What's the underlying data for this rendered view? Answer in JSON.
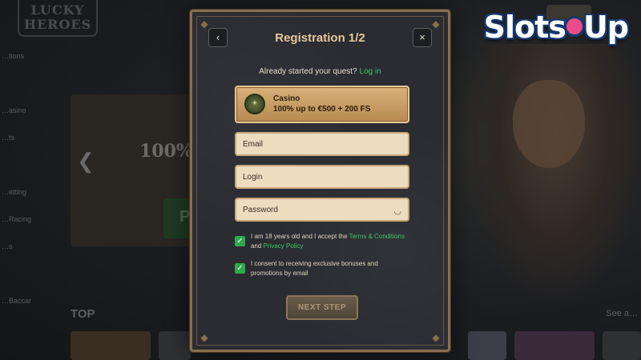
{
  "background": {
    "logo_text": "LUCKY HEROES",
    "sidebar_items": [
      "…tions",
      "",
      "…asino",
      "…ts",
      "",
      "…etting",
      "…Racing",
      "…s",
      "",
      "…Baccar"
    ],
    "banner_text": "100%",
    "banner_button": "P",
    "top_label": "TOP",
    "see_all": "See a…"
  },
  "watermark": {
    "text_left": "Slots",
    "text_right": "Up"
  },
  "modal": {
    "title": "Registration 1/2",
    "back_icon": "chevron-left-icon",
    "close_icon": "close-icon",
    "back_glyph": "‹",
    "close_glyph": "×",
    "quest_text": "Already started your quest?",
    "login_link": "Log in",
    "bonus": {
      "category": "Casino",
      "offer": "100% up to €500 + 200 FS"
    },
    "email_placeholder": "Email",
    "login_placeholder": "Login",
    "password_placeholder": "Password",
    "eye_glyph": "◡",
    "checkbox_terms": {
      "checked": true,
      "text_before": "I am 18 years old and I accept the ",
      "terms_link": "Terms & Conditions",
      "text_and": " and ",
      "privacy_link": "Privacy Policy"
    },
    "checkbox_promo": {
      "checked": true,
      "text": "I consent to receiving exclusive bonuses and promotions by email"
    },
    "check_glyph": "✓",
    "next_button": "NEXT STEP"
  },
  "colors": {
    "accent_gold": "#e7c79a",
    "link_green": "#3fc466",
    "checkbox_green": "#2fa84c"
  }
}
